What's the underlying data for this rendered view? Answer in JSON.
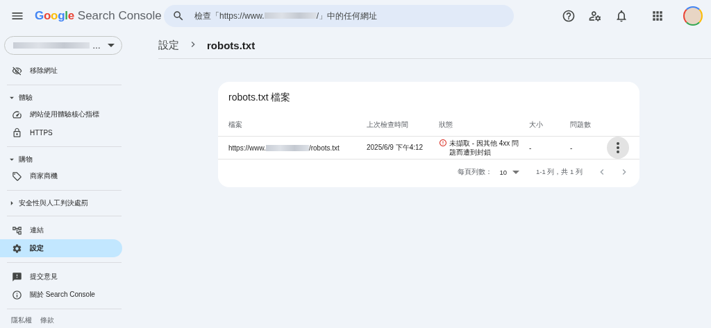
{
  "header": {
    "brand": "Google",
    "product": "Search Console",
    "search": {
      "prefix": "檢查「https://www.",
      "suffix": "/」中的任何網址"
    }
  },
  "property_selector": {
    "value": "…"
  },
  "sidebar": {
    "groups": [
      {
        "items": [
          {
            "label": "移除網址",
            "selected": false
          }
        ]
      },
      {
        "title": "體驗",
        "expanded": true,
        "items": [
          {
            "label": "網站使用體驗核心指標",
            "selected": false
          },
          {
            "label": "HTTPS",
            "selected": false
          }
        ]
      },
      {
        "title": "購物",
        "expanded": true,
        "items": [
          {
            "label": "商家商機",
            "selected": false
          }
        ]
      },
      {
        "title": "安全性與人工判決處罰",
        "expanded": false
      },
      {
        "items": [
          {
            "label": "連結",
            "selected": false
          },
          {
            "label": "設定",
            "selected": true
          }
        ]
      },
      {
        "items": [
          {
            "label": "提交意見",
            "selected": false
          },
          {
            "label": "關於 Search Console",
            "selected": false
          }
        ]
      }
    ],
    "footer": [
      "隱私權",
      "條款"
    ]
  },
  "breadcrumb": [
    "設定",
    "robots.txt"
  ],
  "card": {
    "title": "robots.txt 檔案",
    "columns": [
      "檔案",
      "上次檢查時間",
      "狀態",
      "大小",
      "問題數"
    ],
    "rows": [
      {
        "file_prefix": "https://www.",
        "file_suffix": "/robots.txt",
        "checked": "2025/6/9 下午4:12",
        "status": {
          "kind": "error",
          "text": "未擷取 - 因其他 4xx 問題而遭到封鎖"
        },
        "size": "-",
        "issues": "-"
      }
    ],
    "pagination": {
      "rows_label": "每頁列數：",
      "rows_value": "10",
      "range": "1-1 列，共 1 列"
    }
  }
}
